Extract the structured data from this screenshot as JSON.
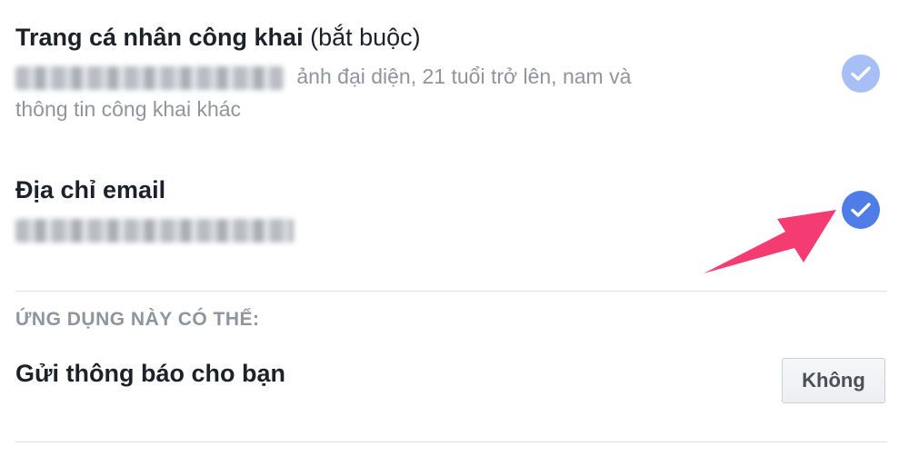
{
  "public_profile": {
    "title": "Trang cá nhân công khai",
    "required_note": "(bắt buộc)",
    "desc_line1": "ảnh đại diện, 21 tuổi trở lên, nam và",
    "desc_line2": "thông tin công khai khác",
    "checked": true,
    "check_color": "#a7bff5"
  },
  "email": {
    "title": "Địa chỉ email",
    "checked": true,
    "check_color": "#4f7de8"
  },
  "app_can": {
    "section_label": "ỨNG DỤNG NÀY CÓ THỂ:",
    "notifications_label": "Gửi thông báo cho bạn",
    "notifications_value": "Không"
  },
  "colors": {
    "arrow": "#f53c72",
    "text_primary": "#1d2129",
    "text_secondary": "#90949c"
  }
}
